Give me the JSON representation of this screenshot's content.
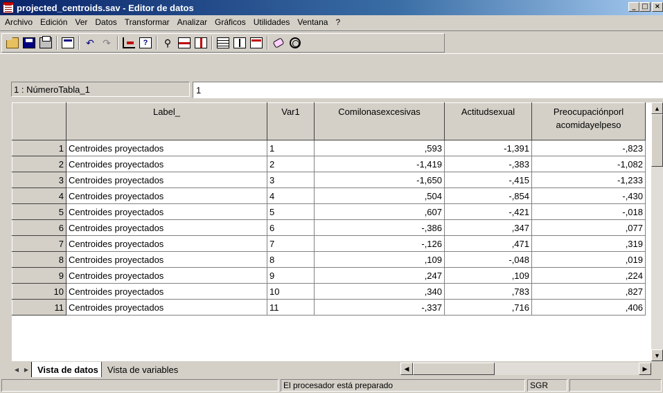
{
  "window": {
    "title": "projected_centroids.sav - Editor de datos"
  },
  "menubar": [
    "Archivo",
    "Edición",
    "Ver",
    "Datos",
    "Transformar",
    "Analizar",
    "Gráficos",
    "Utilidades",
    "Ventana",
    "?"
  ],
  "toolbar": {
    "icons": [
      "open-file-icon",
      "save-icon",
      "print-icon",
      "dialog-recall-icon",
      "undo-icon",
      "redo-icon",
      "goto-case-icon",
      "variables-info-icon",
      "find-icon",
      "insert-case-icon",
      "insert-variable-icon",
      "split-file-icon",
      "weight-cases-icon",
      "select-cases-icon",
      "value-labels-icon",
      "use-sets-icon"
    ]
  },
  "cell_editor": {
    "reference": "1 : NúmeroTabla_1",
    "value": "1"
  },
  "grid": {
    "columns": [
      "Label_",
      "Var1",
      "Comilonasexcesivas",
      "Actitudsexual",
      "Preocupaciónporl acomidayelpeso"
    ],
    "column_lines": [
      [
        "Label_"
      ],
      [
        "Var1"
      ],
      [
        "Comilonasexcesivas"
      ],
      [
        "Actitudsexual"
      ],
      [
        "Preocupaciónporl",
        "acomidayelpeso"
      ]
    ],
    "rows": [
      {
        "n": "1",
        "label": "Centroides proyectados",
        "var1": "1",
        "c1": ",593",
        "c2": "-1,391",
        "c3": "-,823"
      },
      {
        "n": "2",
        "label": "Centroides proyectados",
        "var1": "2",
        "c1": "-1,419",
        "c2": "-,383",
        "c3": "-1,082"
      },
      {
        "n": "3",
        "label": "Centroides proyectados",
        "var1": "3",
        "c1": "-1,650",
        "c2": "-,415",
        "c3": "-1,233"
      },
      {
        "n": "4",
        "label": "Centroides proyectados",
        "var1": "4",
        "c1": ",504",
        "c2": "-,854",
        "c3": "-,430"
      },
      {
        "n": "5",
        "label": "Centroides proyectados",
        "var1": "5",
        "c1": ",607",
        "c2": "-,421",
        "c3": "-,018"
      },
      {
        "n": "6",
        "label": "Centroides proyectados",
        "var1": "6",
        "c1": "-,386",
        "c2": ",347",
        "c3": ",077"
      },
      {
        "n": "7",
        "label": "Centroides proyectados",
        "var1": "7",
        "c1": "-,126",
        "c2": ",471",
        "c3": ",319"
      },
      {
        "n": "8",
        "label": "Centroides proyectados",
        "var1": "8",
        "c1": ",109",
        "c2": "-,048",
        "c3": ",019"
      },
      {
        "n": "9",
        "label": "Centroides proyectados",
        "var1": "9",
        "c1": ",247",
        "c2": ",109",
        "c3": ",224"
      },
      {
        "n": "10",
        "label": "Centroides proyectados",
        "var1": "10",
        "c1": ",340",
        "c2": ",783",
        "c3": ",827"
      },
      {
        "n": "11",
        "label": "Centroides proyectados",
        "var1": "11",
        "c1": "-,337",
        "c2": ",716",
        "c3": ",406"
      }
    ]
  },
  "tabs": {
    "active": "Vista de datos",
    "inactive": "Vista de variables"
  },
  "status": {
    "message": "El procesador  está preparado",
    "indicator": "SGR"
  },
  "colors": {
    "titlebar_start": "#0a246a",
    "titlebar_end": "#a6caf0",
    "chrome": "#d4d0c8"
  }
}
